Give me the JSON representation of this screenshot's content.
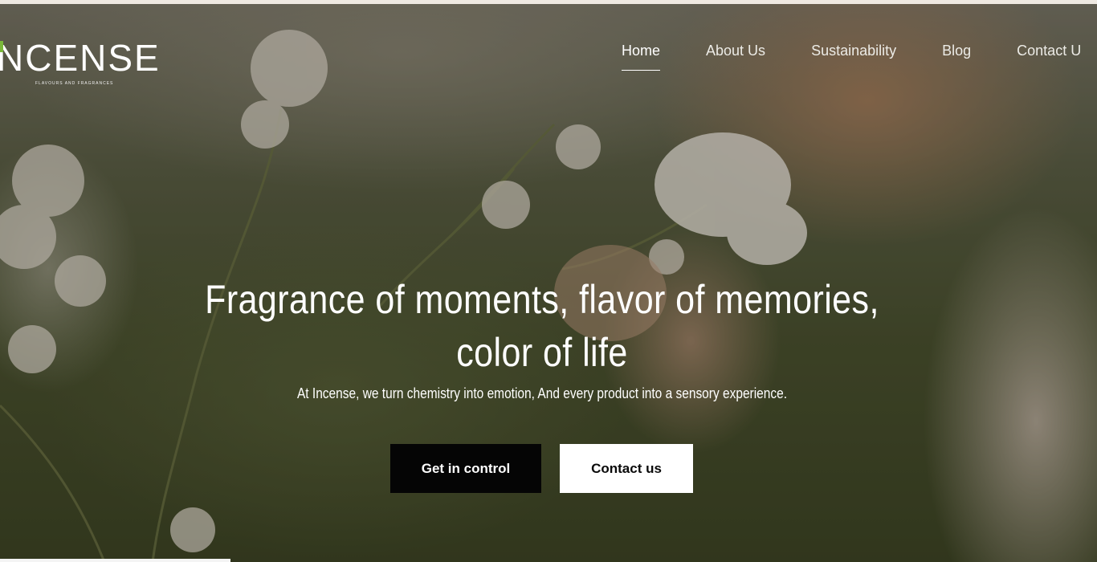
{
  "brand": {
    "name": "NCENSE",
    "tagline": "FLAVOURS AND FRAGRANCES",
    "accent_color": "#7ab83a"
  },
  "nav": {
    "items": [
      {
        "label": "Home",
        "active": true
      },
      {
        "label": "About Us",
        "active": false
      },
      {
        "label": "Sustainability",
        "active": false
      },
      {
        "label": "Blog",
        "active": false
      },
      {
        "label": "Contact U",
        "active": false
      }
    ]
  },
  "hero": {
    "title_line1": "Fragrance of moments, flavor of memories,",
    "title_line2": "color of life",
    "subtitle": "At Incense, we turn chemistry into emotion, And every product into a sensory experience.",
    "primary_button": "Get in control",
    "secondary_button": "Contact us"
  },
  "colors": {
    "primary_button_bg": "#050505",
    "secondary_button_bg": "#ffffff",
    "text": "#ffffff"
  }
}
